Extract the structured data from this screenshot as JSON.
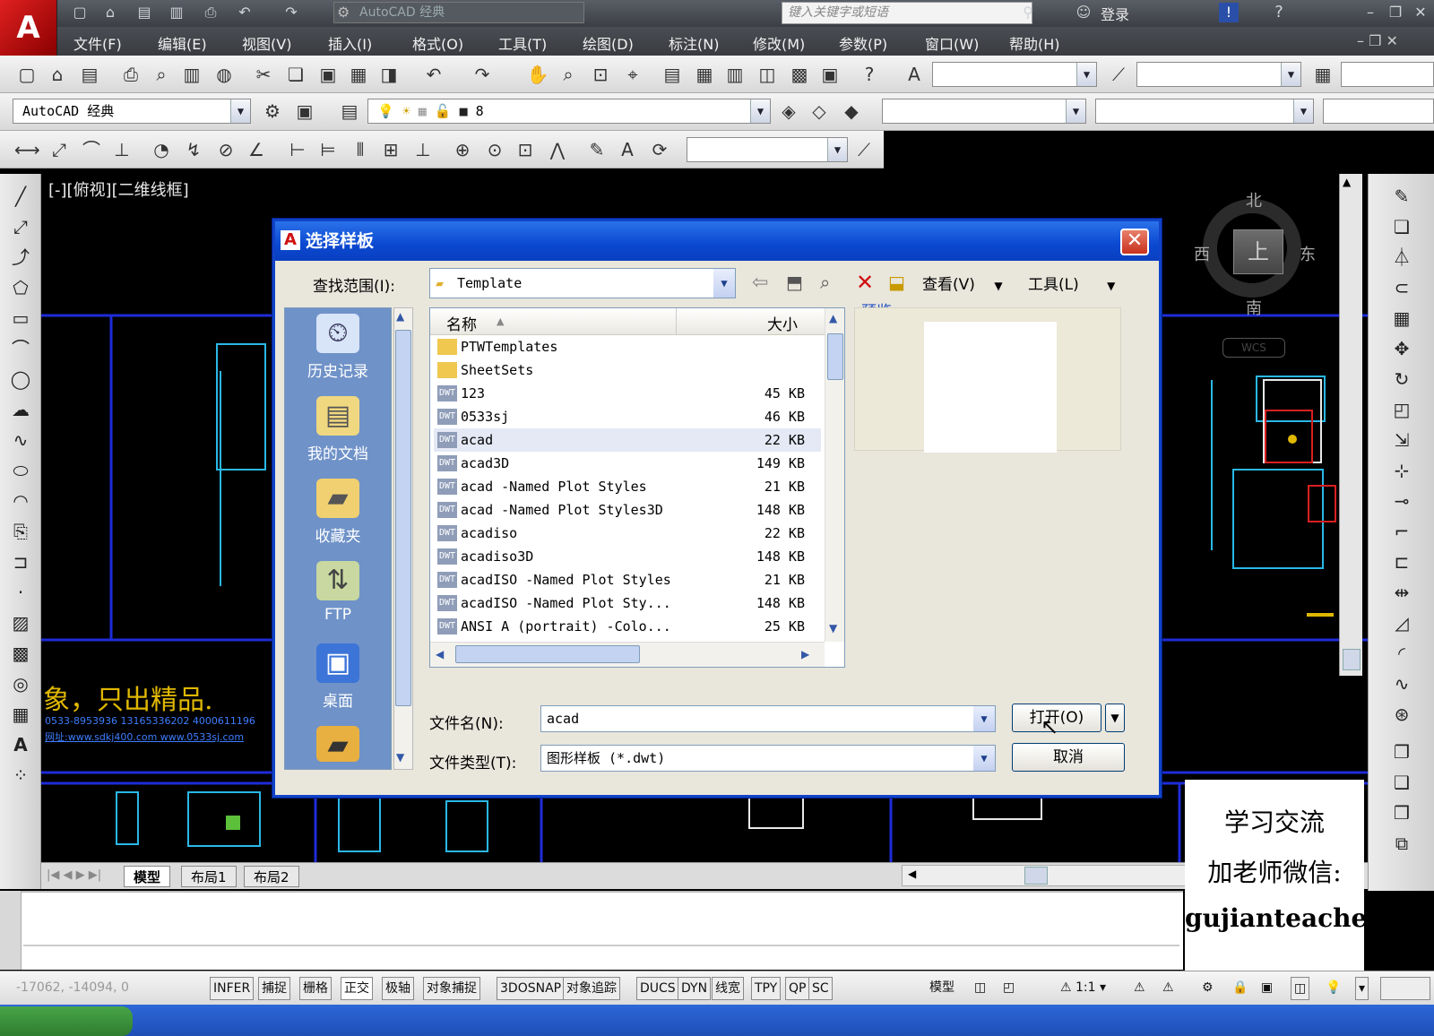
{
  "app": {
    "workspace_combo": "AutoCAD 经典",
    "search_placeholder": "键入关键字或短语",
    "login": "登录"
  },
  "menu": [
    "文件(F)",
    "编辑(E)",
    "视图(V)",
    "插入(I)",
    "格式(O)",
    "工具(T)",
    "绘图(D)",
    "标注(N)",
    "修改(M)",
    "参数(P)",
    "窗口(W)",
    "帮助(H)"
  ],
  "toolbar2": {
    "workspace": "AutoCAD 经典",
    "layer": "8"
  },
  "canvas": {
    "viewport_label": "[-][俯视][二维线框]",
    "banner": "象，只出精品.",
    "contact_phone": "0533-8953936 13165336202 4000611196",
    "contact_web": "网址:www.sdkj400.com www.0533sj.com",
    "compass": {
      "north": "北",
      "south": "南",
      "east": "东",
      "west": "西",
      "top": "上",
      "wcs": "WCS"
    }
  },
  "layout_tabs": [
    "模型",
    "布局1",
    "布局2"
  ],
  "wechat": {
    "line1": "学习交流",
    "line2": "加老师微信:",
    "id": "gujianteacher"
  },
  "statusbar": {
    "coords": "-17062, -14094, 0",
    "toggles": [
      "INFER",
      "捕捉",
      "栅格",
      "正交",
      "极轴",
      "对象捕捉",
      "3DOSNAP",
      "对象追踪",
      "DUCS",
      "DYN",
      "线宽",
      "TPY",
      "QP",
      "SC"
    ],
    "model": "模型",
    "scale": "1:1"
  },
  "dialog": {
    "title": "选择样板",
    "lookin_label": "查找范围(I):",
    "lookin_value": "Template",
    "views_label": "查看(V)",
    "tools_label": "工具(L)",
    "preview_label": "预览",
    "places": [
      "历史记录",
      "我的文档",
      "收藏夹",
      "FTP",
      "桌面"
    ],
    "col_name": "名称",
    "col_size": "大小",
    "files": [
      {
        "name": "PTWTemplates",
        "size": "",
        "type": "folder"
      },
      {
        "name": "SheetSets",
        "size": "",
        "type": "folder"
      },
      {
        "name": "123",
        "size": "45 KB",
        "type": "dwt"
      },
      {
        "name": "0533sj",
        "size": "46 KB",
        "type": "dwt"
      },
      {
        "name": "acad",
        "size": "22 KB",
        "type": "dwt"
      },
      {
        "name": "acad3D",
        "size": "149 KB",
        "type": "dwt"
      },
      {
        "name": "acad -Named Plot Styles",
        "size": "21 KB",
        "type": "dwt"
      },
      {
        "name": "acad -Named Plot Styles3D",
        "size": "148 KB",
        "type": "dwt"
      },
      {
        "name": "acadiso",
        "size": "22 KB",
        "type": "dwt"
      },
      {
        "name": "acadiso3D",
        "size": "148 KB",
        "type": "dwt"
      },
      {
        "name": "acadISO -Named Plot Styles",
        "size": "21 KB",
        "type": "dwt"
      },
      {
        "name": "acadISO -Named Plot Sty...",
        "size": "148 KB",
        "type": "dwt"
      },
      {
        "name": "ANSI A (portrait) -Colo...",
        "size": "25 KB",
        "type": "dwt"
      }
    ],
    "filename_label": "文件名(N):",
    "filename_value": "acad",
    "filetype_label": "文件类型(T):",
    "filetype_value": "图形样板 (*.dwt)",
    "open_button": "打开(O)",
    "cancel_button": "取消"
  }
}
